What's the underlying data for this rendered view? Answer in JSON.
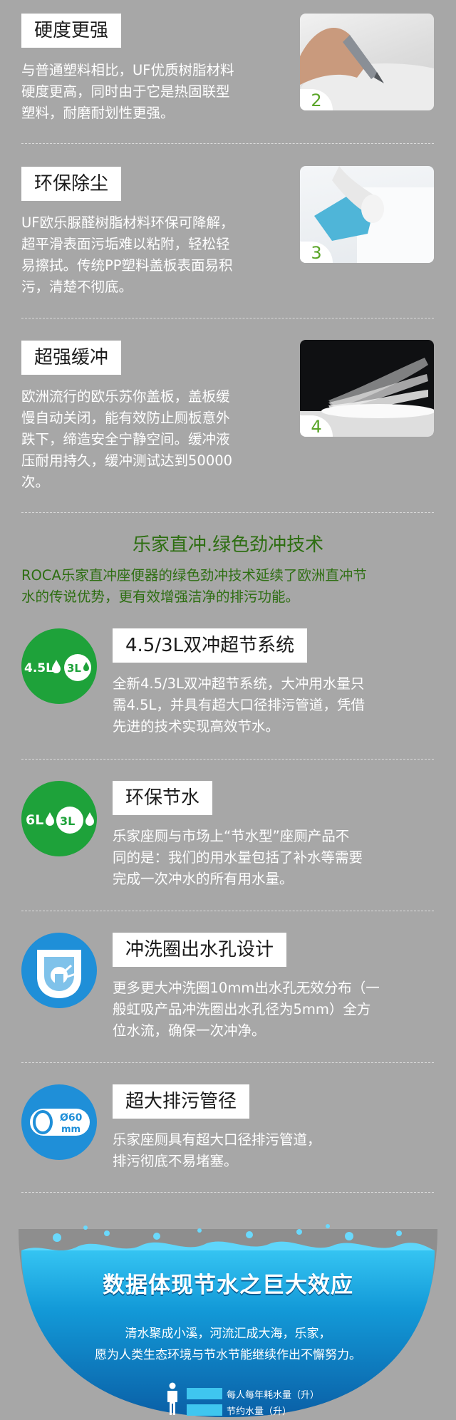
{
  "features_top": [
    {
      "title": "硬度更强",
      "number": "2",
      "lines": [
        "与普通塑料相比，UF优质树脂材料",
        "硬度更高，同时由于它是热固联型",
        "塑料，耐磨耐划性更强。"
      ]
    },
    {
      "title": "环保除尘",
      "number": "3",
      "lines": [
        "UF欧乐脲醛树脂材料环保可降解，",
        "超平滑表面污垢难以粘附，轻松轻",
        "易擦拭。传统PP塑料盖板表面易积",
        "污，清楚不彻底。"
      ]
    },
    {
      "title": "超强缓冲",
      "number": "4",
      "lines": [
        "欧洲流行的欧乐苏你盖板，盖板缓",
        "慢自动关闭，能有效防止厕板意外",
        "跌下，缔造安全宁静空间。缓冲液",
        "压耐用持久，缓冲测试达到50000",
        "次。"
      ]
    }
  ],
  "section": {
    "title": "乐家直冲.绿色劲冲技术",
    "desc_lines": [
      "ROCA乐家直冲座便器的绿色劲冲技术延续了欧洲直冲节",
      "水的传说优势，更有效增强洁净的排污功能。"
    ]
  },
  "features": [
    {
      "title": "4.5/3L双冲超节系统",
      "icon": "dual-flush-4.5-3-icon",
      "icon_label_a": "4.5L",
      "icon_label_b": "3L",
      "icon_color": "#1ea23a",
      "lines": [
        "全新4.5/3L双冲超节系统，大冲用水量只",
        "需4.5L，并具有超大口径排污管道，凭借",
        "先进的技术实现高效节水。"
      ]
    },
    {
      "title": "环保节水",
      "icon": "eco-water-6-3-icon",
      "icon_label_a": "6L",
      "icon_label_b": "3L",
      "icon_color": "#1ea23a",
      "lines": [
        "乐家座厕与市场上“节水型”座厕产品不",
        "同的是：我们的用水量包括了补水等需要",
        "完成一次冲水的所有用水量。"
      ]
    },
    {
      "title": "冲洗圈出水孔设计",
      "icon": "flush-rim-icon",
      "icon_color": "#1f8fd8",
      "lines": [
        "更多更大冲洗圈10mm出水孔无效分布（一",
        "般虹吸产品冲洗圈出水孔径为5mm）全方",
        "位水流，确保一次冲净。"
      ]
    },
    {
      "title": "超大排污管径",
      "icon": "pipe-diameter-icon",
      "icon_label_a": "Ø60",
      "icon_label_b": "mm",
      "icon_color": "#1f8fd8",
      "lines": [
        "乐家座厕具有超大口径排污管道，",
        "排污彻底不易堵塞。"
      ]
    }
  ],
  "banner": {
    "title": "数据体现节水之巨大效应",
    "lines": [
      "清水聚成小溪，河流汇成大海，乐家，",
      "愿为人类生态环境与节水节能继续作出不懈努力。"
    ],
    "legend": [
      {
        "label": "每人每年耗水量（升）",
        "color": "#3fc6ef"
      },
      {
        "label": "节约水量（升）",
        "color": "#3fc6ef"
      }
    ]
  }
}
